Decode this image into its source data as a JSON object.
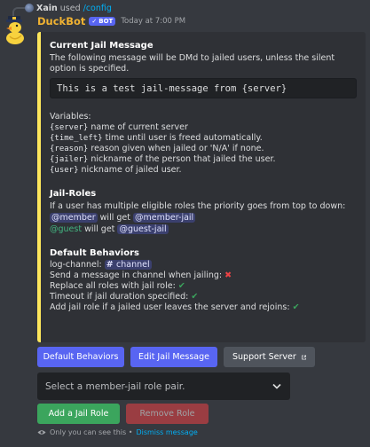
{
  "reply": {
    "user": "Xain",
    "action": "used",
    "command": "/config"
  },
  "message": {
    "author": "DuckBot",
    "bot_tag": "BOT",
    "timestamp": "Today at 7:00 PM"
  },
  "embed": {
    "accent_color": "#fee75c",
    "section1_title": "Current Jail Message",
    "section1_desc": "The following message will be DMd to jailed users, unless the silent option is specified.",
    "jail_message": "This is a test jail-message from {server}",
    "variables_label": "Variables:",
    "variables": [
      {
        "name": "{server}",
        "desc": " name of current server"
      },
      {
        "name": "{time_left}",
        "desc": " time until user is freed automatically."
      },
      {
        "name": "{reason}",
        "desc": " reason given when jailed or 'N/A' if none."
      },
      {
        "name": "{jailer}",
        "desc": " nickname of the person that jailed the user."
      },
      {
        "name": "{user}",
        "desc": " nickname of jailed user."
      }
    ],
    "section2_title": "Jail-Roles",
    "section2_desc": "If a user has multiple eligible roles the priority goes from top to down:",
    "role_pairs": [
      {
        "role": "@member",
        "will_get": " will get ",
        "jail_role": "@member-jail"
      },
      {
        "role": "@guest",
        "will_get": " will get ",
        "jail_role": "@guest-jail"
      }
    ],
    "section3_title": "Default Behaviors",
    "log_channel_label": "log-channel: ",
    "log_channel": "channel",
    "behaviors": [
      {
        "text": "Send a message in channel when jailing: ",
        "enabled": false,
        "icon": "cross-icon"
      },
      {
        "text": "Replace all roles with jail role: ",
        "enabled": true,
        "icon": "check-icon"
      },
      {
        "text": "Timeout if jail duration specified: ",
        "enabled": true,
        "icon": "check-icon"
      },
      {
        "text": "Add jail role if a jailed user leaves the server and rejoins: ",
        "enabled": true,
        "icon": "check-icon"
      }
    ]
  },
  "buttons": {
    "default_behaviors": "Default Behaviors",
    "edit_jail_message": "Edit Jail Message",
    "support_server": "Support Server",
    "add_jail_role": "Add a Jail Role",
    "remove_role": "Remove Role"
  },
  "select": {
    "placeholder": "Select a member-jail role pair."
  },
  "footer": {
    "text": "Only you can see this • ",
    "link": "Dismiss message"
  }
}
